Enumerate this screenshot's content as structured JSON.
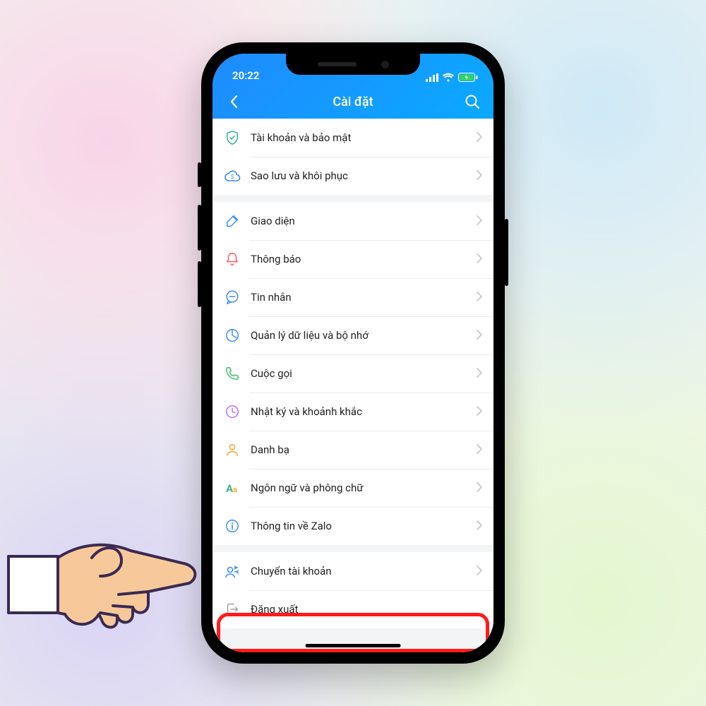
{
  "status": {
    "time": "20:22"
  },
  "nav": {
    "title": "Cài đặt"
  },
  "groups": [
    {
      "rows": [
        {
          "icon": "shield",
          "color": "#2fb280",
          "label": "Tài khoản và bảo mật"
        },
        {
          "icon": "cloud",
          "color": "#3a8ff3",
          "label": "Sao lưu và khôi phục"
        }
      ]
    },
    {
      "rows": [
        {
          "icon": "brush",
          "color": "#3a8ff3",
          "label": "Giao diện"
        },
        {
          "icon": "bell",
          "color": "#ff5a5a",
          "label": "Thông báo"
        },
        {
          "icon": "chat",
          "color": "#3a8ff3",
          "label": "Tin nhắn"
        },
        {
          "icon": "pie",
          "color": "#3a8ff3",
          "label": "Quản lý dữ liệu và bộ nhớ"
        },
        {
          "icon": "phone",
          "color": "#3fbf6d",
          "label": "Cuộc gọi"
        },
        {
          "icon": "clock",
          "color": "#b96cf0",
          "label": "Nhật ký và khoảnh khắc"
        },
        {
          "icon": "person",
          "color": "#f7a62b",
          "label": "Danh bạ"
        },
        {
          "icon": "aa",
          "color": "#2fb280",
          "label": "Ngôn ngữ và phông chữ"
        },
        {
          "icon": "info",
          "color": "#3a8ff3",
          "label": "Thông tin về Zalo"
        }
      ]
    },
    {
      "rows": [
        {
          "icon": "switch",
          "color": "#3a8ff3",
          "label": "Chuyển tài khoản"
        },
        {
          "icon": "logout",
          "color": "#9ca0a5",
          "label": "Đăng xuất",
          "noChevron": true
        }
      ]
    }
  ]
}
